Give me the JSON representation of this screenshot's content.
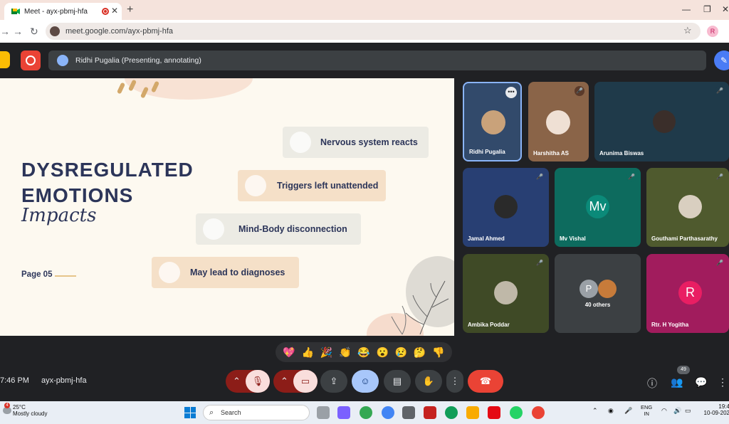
{
  "browser": {
    "tab_title": "Meet - ayx-pbmj-hfa",
    "new_tab": "+",
    "url": "meet.google.com/ayx-pbmj-hfa",
    "profile_initial": "R",
    "window_controls": [
      "—",
      "❐",
      "✕"
    ]
  },
  "meet": {
    "presenting_label": "Ridhi Pugalia (Presenting, annotating)",
    "time": "7:46 PM",
    "meeting_code": "ayx-pbmj-hfa",
    "people_count": "49"
  },
  "slide": {
    "title_line1": "DYSREGULATED",
    "title_line2": "EMOTIONS",
    "subtitle_script": "Impacts",
    "page_label": "Page 05",
    "points": [
      "Nervous system reacts",
      "Triggers left unattended",
      "Mind-Body disconnection",
      "May lead to diagnoses"
    ]
  },
  "participants": [
    {
      "name": "Ridhi Pugalia",
      "bg": "#324a6b"
    },
    {
      "name": "Harshitha AS",
      "bg": "#8a6448"
    },
    {
      "name": "Arunima Biswas",
      "bg": "#1f3a4a"
    },
    {
      "name": "Jamal Ahmed",
      "bg": "#283f73"
    },
    {
      "name": "Mv Vishal",
      "initials": "Mv",
      "bg": "#0d6b5e"
    },
    {
      "name": "Gouthami Parthasarathy",
      "bg": "#4f5a2e"
    },
    {
      "name": "Ambika Poddar",
      "bg": "#3f4a26"
    },
    {
      "name": "40 others",
      "initials": "P",
      "bg": "#3c4043"
    },
    {
      "name": "Rtr. H Yogitha",
      "initials": "R",
      "bg": "#a11c5d"
    }
  ],
  "reactions": [
    "💖",
    "👍",
    "🎉",
    "👏",
    "😂",
    "😮",
    "😢",
    "🤔",
    "👎"
  ],
  "taskbar": {
    "temperature": "25°C",
    "weather": "Mostly cloudy",
    "weather_badge": "4",
    "search_placeholder": "Search",
    "lang_line1": "ENG",
    "lang_line2": "IN",
    "clock_time": "19:4",
    "clock_date": "10-09-202"
  },
  "colors": {
    "meet_bg": "#202124",
    "end_call": "#ea4335",
    "accent_blue": "#a8c7fa",
    "slide_navy": "#2c3559"
  }
}
